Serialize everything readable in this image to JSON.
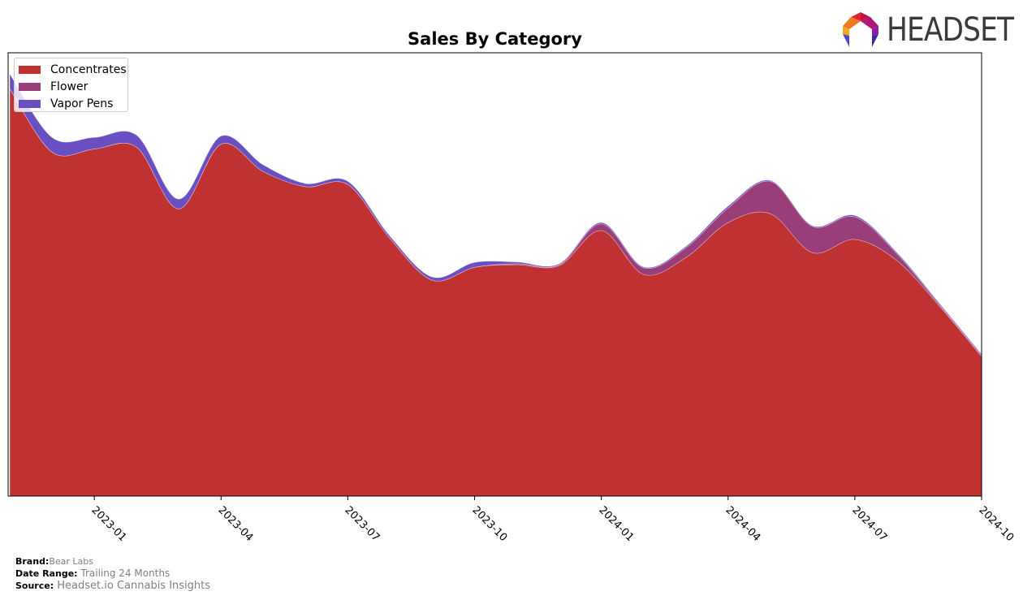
{
  "header": {
    "logo_text": "HEADSET",
    "logo_icon": "headset-logo-icon"
  },
  "chart_data": {
    "type": "area",
    "stacked": true,
    "smooth": true,
    "title": "Sales By Category",
    "xlabel": "",
    "ylabel": "",
    "yaxis_visible": false,
    "ylim": [
      0,
      100
    ],
    "legend_position": "top-left",
    "x": [
      "2022-11",
      "2022-12",
      "2023-01",
      "2023-02",
      "2023-03",
      "2023-04",
      "2023-05",
      "2023-06",
      "2023-07",
      "2023-08",
      "2023-09",
      "2023-10",
      "2023-11",
      "2023-12",
      "2024-01",
      "2024-02",
      "2024-03",
      "2024-04",
      "2024-05",
      "2024-06",
      "2024-07",
      "2024-08",
      "2024-09",
      "2024-10"
    ],
    "xticks": [
      "2023-01",
      "2023-04",
      "2023-07",
      "2023-10",
      "2024-01",
      "2024-04",
      "2024-07",
      "2024-10"
    ],
    "series": [
      {
        "name": "Concentrates",
        "color": "#c03232",
        "values": [
          91.9,
          77.6,
          78.3,
          78.7,
          64.8,
          79.4,
          73.2,
          69.8,
          70.3,
          58.1,
          48.7,
          51.6,
          52.2,
          52.0,
          59.9,
          50.0,
          53.8,
          61.7,
          63.7,
          54.9,
          57.9,
          53.1,
          42.9,
          31.5
        ]
      },
      {
        "name": "Flower",
        "color": "#993e78",
        "values": [
          0,
          0,
          0,
          0,
          0,
          0,
          0,
          0,
          0,
          0,
          0,
          0,
          0.2,
          0.2,
          1.5,
          1.5,
          2.2,
          3.3,
          7.3,
          5.9,
          5.1,
          1.5,
          0.3,
          0.2
        ]
      },
      {
        "name": "Vapor Pens",
        "color": "#6a4fc2",
        "values": [
          3.3,
          3.3,
          2.6,
          2.7,
          2.2,
          1.8,
          1.5,
          0.7,
          0.7,
          0.5,
          0.7,
          1.1,
          0.4,
          0.2,
          0.3,
          0.2,
          0.3,
          0.4,
          0.2,
          0.2,
          0.3,
          0.3,
          0.3,
          0.3
        ]
      }
    ]
  },
  "footer": {
    "brand_label": "Brand:",
    "brand_value": "Bear Labs",
    "date_range_label": "Date Range:",
    "date_range_value": "Trailing 24 Months",
    "source_label": "Source:",
    "source_value": "Headset.io Cannabis Insights"
  }
}
